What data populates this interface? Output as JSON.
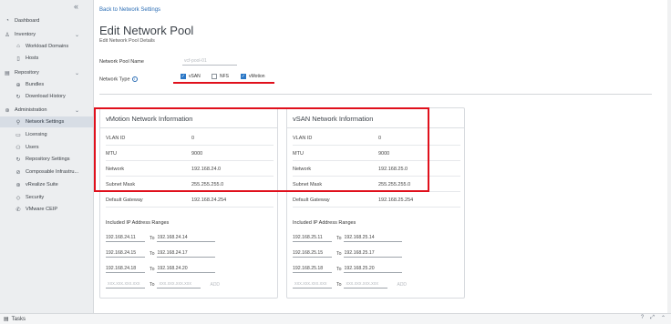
{
  "sidebar": {
    "items": [
      {
        "label": "Dashboard",
        "icon": "◔",
        "level": "top"
      },
      {
        "label": "Inventory",
        "icon": "♙",
        "level": "top",
        "expand": "⌄"
      },
      {
        "label": "Workload Domains",
        "icon": "⌂",
        "level": "sub"
      },
      {
        "label": "Hosts",
        "icon": "▯",
        "level": "sub"
      },
      {
        "label": "Repository",
        "icon": "▤",
        "level": "top",
        "expand": "⌄"
      },
      {
        "label": "Bundles",
        "icon": "⊕",
        "level": "sub"
      },
      {
        "label": "Download History",
        "icon": "↻",
        "level": "sub"
      },
      {
        "label": "Administration",
        "icon": "⊛",
        "level": "top",
        "expand": "⌄"
      },
      {
        "label": "Network Settings",
        "icon": "⚲",
        "level": "sub",
        "active": true
      },
      {
        "label": "Licensing",
        "icon": "▭",
        "level": "sub"
      },
      {
        "label": "Users",
        "icon": "⚇",
        "level": "sub"
      },
      {
        "label": "Repository Settings",
        "icon": "↻",
        "level": "sub"
      },
      {
        "label": "Composable Infrastru...",
        "icon": "⊘",
        "level": "sub"
      },
      {
        "label": "vRealize Suite",
        "icon": "⊛",
        "level": "sub"
      },
      {
        "label": "Security",
        "icon": "◇",
        "level": "sub"
      },
      {
        "label": "VMware CEIP",
        "icon": "✆",
        "level": "sub"
      }
    ],
    "collapse_icon": "«"
  },
  "header": {
    "back_link": "Back to Network Settings",
    "title": "Edit Network Pool",
    "subtitle": "Edit Network Pool Details"
  },
  "form": {
    "pool_name_label": "Network Pool Name",
    "pool_name_value": "vcf-pool-01",
    "network_type_label": "Network Type",
    "types": [
      {
        "label": "vSAN",
        "checked": true
      },
      {
        "label": "NFS",
        "checked": false
      },
      {
        "label": "vMotion",
        "checked": true
      }
    ]
  },
  "vmotion": {
    "title": "vMotion Network Information",
    "rows": [
      {
        "label": "VLAN ID",
        "value": "0"
      },
      {
        "label": "MTU",
        "value": "9000"
      },
      {
        "label": "Network",
        "value": "192.168.24.0"
      },
      {
        "label": "Subnet Mask",
        "value": "255.255.255.0"
      },
      {
        "label": "Default Gateway",
        "value": "192.168.24.254"
      }
    ],
    "ip_heading": "Included IP Address Ranges",
    "ranges": [
      {
        "from": "192.168.24.11",
        "to": "192.168.24.14"
      },
      {
        "from": "192.168.24.15",
        "to": "192.168.24.17"
      },
      {
        "from": "192.168.24.18",
        "to": "192.168.24.20"
      }
    ]
  },
  "vsan": {
    "title": "vSAN Network Information",
    "rows": [
      {
        "label": "VLAN ID",
        "value": "0"
      },
      {
        "label": "MTU",
        "value": "9000"
      },
      {
        "label": "Network",
        "value": "192.168.25.0"
      },
      {
        "label": "Subnet Mask",
        "value": "255.255.255.0"
      },
      {
        "label": "Default Gateway",
        "value": "192.168.25.254"
      }
    ],
    "ip_heading": "Included IP Address Ranges",
    "ranges": [
      {
        "from": "192.168.25.11",
        "to": "192.168.25.14"
      },
      {
        "from": "192.168.25.15",
        "to": "192.168.25.17"
      },
      {
        "from": "192.168.25.18",
        "to": "192.168.25.20"
      }
    ]
  },
  "new_range": {
    "from_placeholder": "xxx.xxx.xxx.xxx",
    "to_label": "To",
    "to_placeholder": "xxx.xxx.xxx.xxx",
    "add_label": "ADD"
  },
  "to_word": "To",
  "footer": {
    "tasks_label": "Tasks",
    "icons": [
      "?",
      "⤢",
      "⌃"
    ]
  },
  "colors": {
    "accent": "#2a77c6",
    "highlight": "#e0101c"
  }
}
